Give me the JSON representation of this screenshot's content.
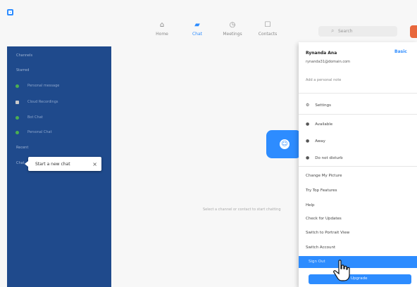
{
  "app": {
    "icon": "app-icon",
    "accent_color": "#2d8cff"
  },
  "nav": {
    "items": [
      {
        "label": "Home",
        "icon": "home-icon",
        "active": false
      },
      {
        "label": "Chat",
        "icon": "chat-icon",
        "active": true
      },
      {
        "label": "Meetings",
        "icon": "clock-icon",
        "active": false
      },
      {
        "label": "Contacts",
        "icon": "contacts-icon",
        "active": false
      }
    ],
    "search_placeholder": "Search"
  },
  "left_panel": {
    "color": "#1f4a8c",
    "heading": "Channels",
    "section_label": "Starred",
    "rows": [
      {
        "text": "Personal message",
        "dot_color": "#4caf50"
      },
      {
        "text": "Cloud Recordings",
        "dot_color": "#c9c9c9"
      },
      {
        "text": "Bot Chat",
        "dot_color": "#4caf50"
      },
      {
        "text": "Personal Chat",
        "dot_color": "#4caf50"
      }
    ],
    "recent_label": "Recent",
    "label": "Chat",
    "tooltip": "Start a new chat",
    "tooltip_close": "×"
  },
  "center": {
    "text": "Select a channel or contact to start chatting"
  },
  "profile_menu": {
    "name": "Rynanda Ana",
    "badge": "Basic",
    "email": "rynanda31@domain.com",
    "field": "Add a personal note",
    "items": [
      "Settings",
      "Available",
      "Away",
      "Do not disturb",
      "Change My Picture",
      "Try Top Features",
      "Help",
      "Check for Updates",
      "Switch to Portrait View",
      "Switch Account"
    ],
    "highlight_item": "Sign Out",
    "button_label": "Upgrade"
  }
}
